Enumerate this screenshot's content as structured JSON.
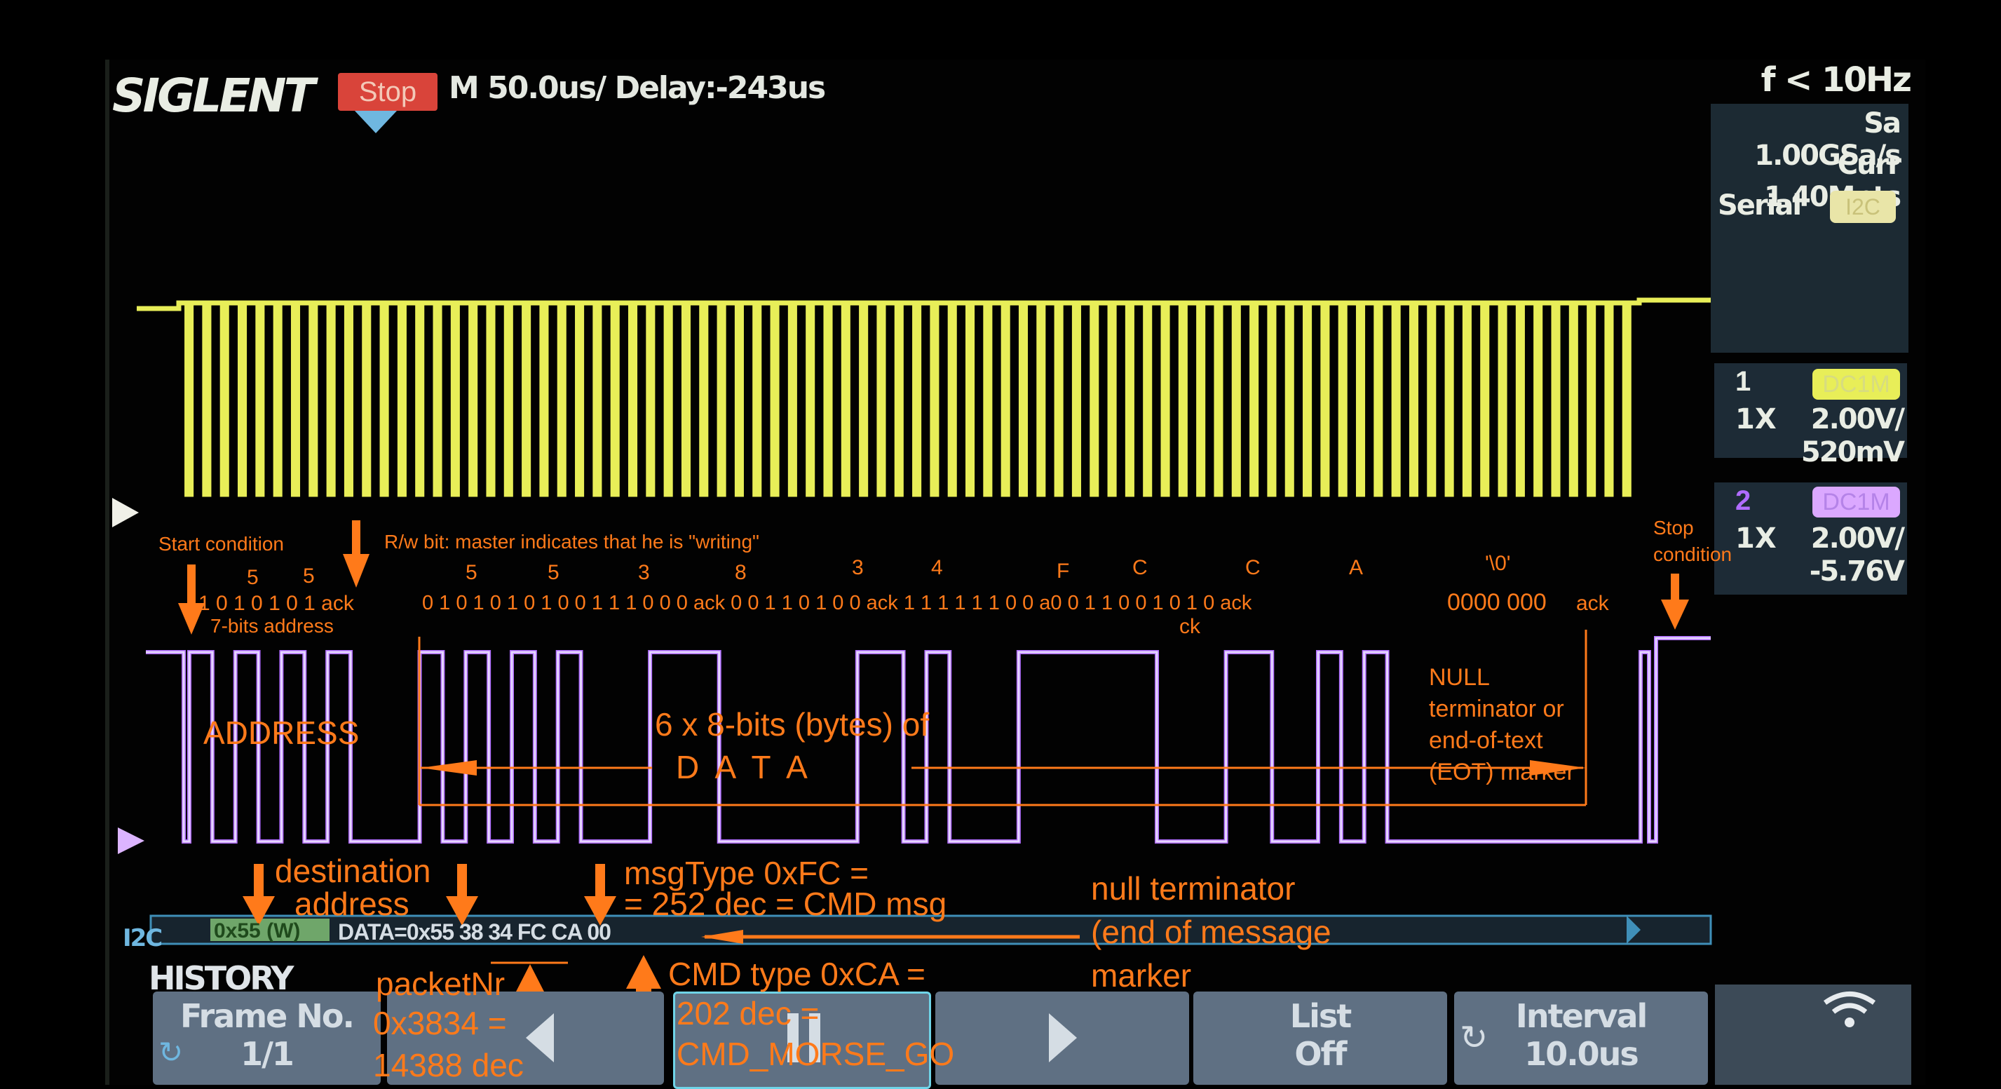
{
  "header": {
    "brand": "SIGLENT",
    "run_state": "Stop",
    "timebase": "M 50.0us/  Delay:-243us"
  },
  "info": {
    "freq": "f < 10Hz",
    "sample_rate": "Sa 1.00GSa/s",
    "memory": "Curr 1.40Mpts",
    "serial_label": "Serial",
    "serial_badge": "I2C"
  },
  "channels": [
    {
      "num": "1",
      "coupling": "DC1M",
      "probe": "1X",
      "scale": "2.00V/",
      "offset": "520mV",
      "color": "#e8ee58"
    },
    {
      "num": "2",
      "coupling": "DC1M",
      "probe": "1X",
      "scale": "2.00V/",
      "offset": "-5.76V",
      "color": "#b06cff"
    }
  ],
  "decode_bar": {
    "prefix": "I2C",
    "address": "0x55 (W)",
    "data": "DATA=0x55 38 34 FC CA 00"
  },
  "softkeys": {
    "history": "HISTORY",
    "frame_label": "Frame No.",
    "frame_value": "1/1",
    "list_label": "List",
    "list_value": "Off",
    "interval_label": "Interval",
    "interval_value": "10.0us"
  },
  "annotations": {
    "start_condition": "Start condition",
    "rw_bit": "R/w bit: master indicates that he is \"writing\"",
    "seven_bits": "7-bits address",
    "stop_condition_1": "Stop",
    "stop_condition_2": "condition",
    "address": "ADDRESS",
    "data_title": "6 x 8-bits (bytes) of",
    "data_letters": "D   A   T   A",
    "null_term_1": "NULL",
    "null_term_2": "terminator or",
    "null_term_3": "end-of-text",
    "null_term_4": "(EOT) marker",
    "dest_1": "destination",
    "dest_2": "address",
    "msgtype_1": "msgType 0xFC =",
    "msgtype_2": "= 252 dec = CMD msg",
    "null_1": "null terminator",
    "null_2": "(end of message",
    "null_3": "marker",
    "packet_1": "packetNr",
    "packet_2": "0x3834 =",
    "packet_3": "14388 dec",
    "cmd_1": "CMD type 0xCA =",
    "cmd_2": "202 dec =",
    "cmd_3": "CMD_MORSE_GO",
    "hex_digits": [
      "5",
      "5",
      "5",
      "5",
      "3",
      "8",
      "3",
      "4",
      "F",
      "C",
      "C",
      "A",
      "'\\0'"
    ],
    "bit_groups": [
      "1 0 1 0 1 0 1  ack",
      "0 1   0 1 0 1 0   1   0 0   1 1    1 0 0 0  ack 0 0    1 1    0 1  0 0   ack  1 1 1    1 1    1  0 0 a0 0 1 1    0 0    1 0 1 0 ack",
      "0000 000",
      "ack",
      "ck"
    ]
  }
}
